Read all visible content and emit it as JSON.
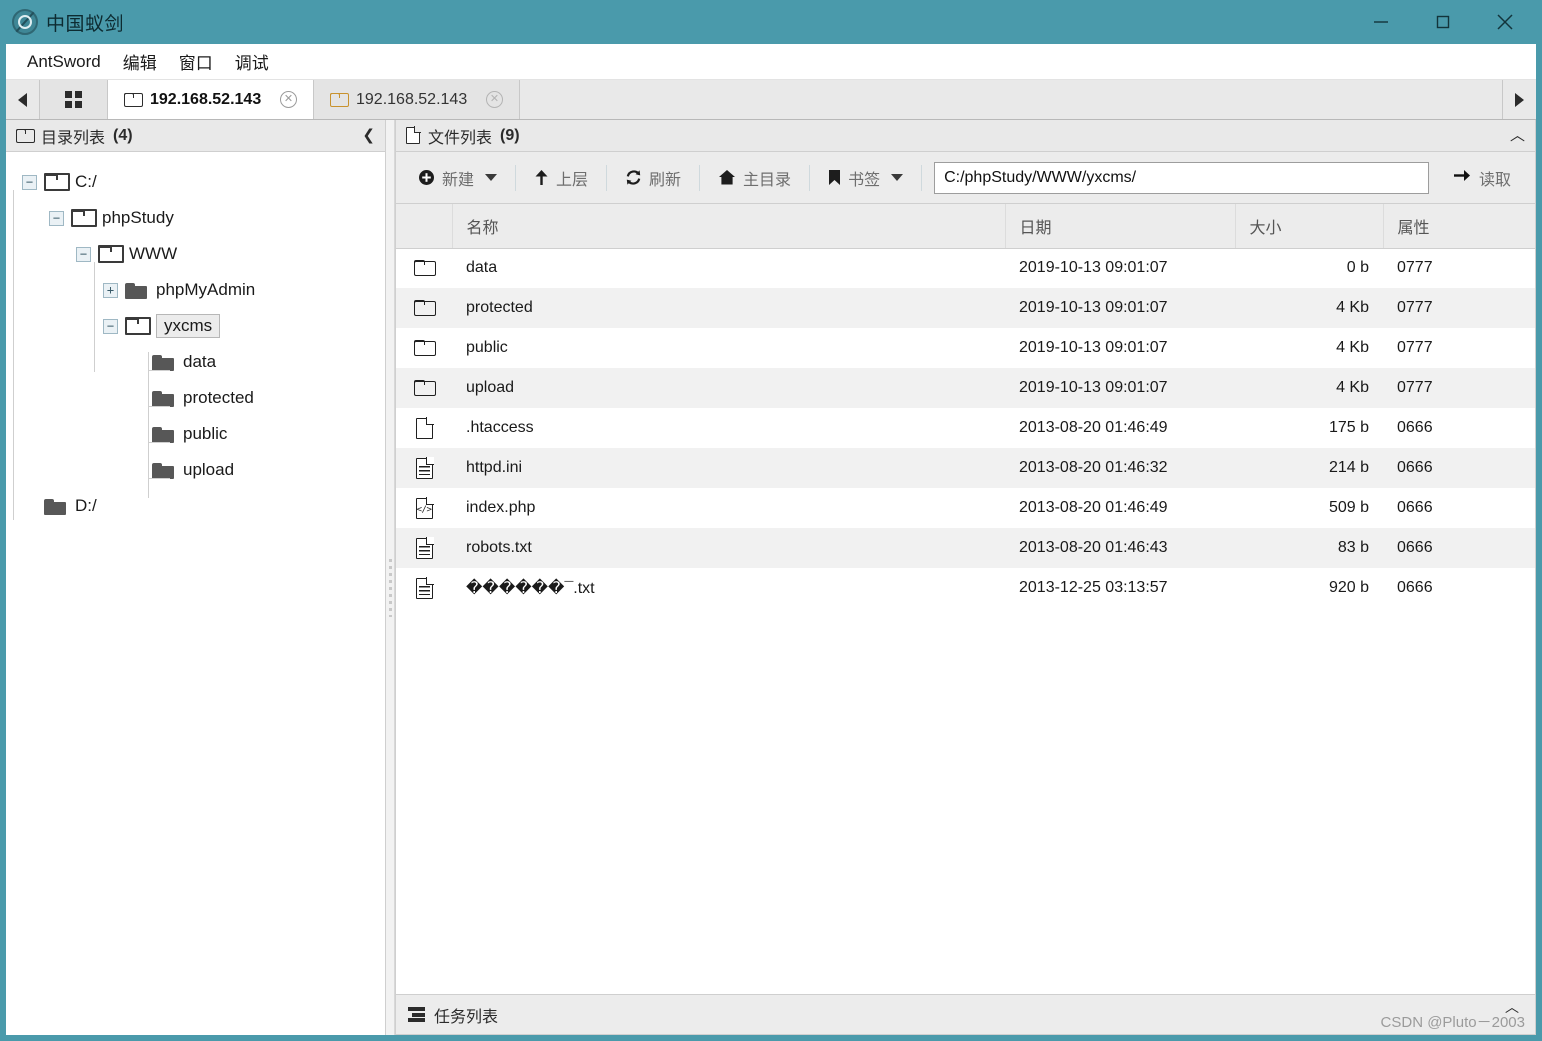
{
  "window": {
    "title": "中国蚁剑",
    "logo_icon": "antsword-logo-icon",
    "controls": {
      "minimize": "minimize-icon",
      "maximize": "maximize-icon",
      "close": "close-icon"
    }
  },
  "menubar": {
    "items": [
      {
        "label": "AntSword"
      },
      {
        "label": "编辑"
      },
      {
        "label": "窗口"
      },
      {
        "label": "调试"
      }
    ]
  },
  "tabbar": {
    "scroll_left_icon": "chevron-left-icon",
    "scroll_right_icon": "chevron-right-icon",
    "home_icon": "grid-icon",
    "tabs": [
      {
        "label": "192.168.52.143",
        "active": true,
        "close_icon": "close-circle-icon"
      },
      {
        "label": "192.168.52.143",
        "active": false,
        "close_icon": "close-circle-icon"
      }
    ]
  },
  "sidebar": {
    "header": {
      "icon": "folder-icon",
      "title": "目录列表",
      "count": "(4)",
      "collapse_icon": "chevron-left-icon"
    },
    "tree": [
      {
        "label": "C:/",
        "depth": 0,
        "toggle": "minus",
        "folder": "open",
        "selected": false
      },
      {
        "label": "phpStudy",
        "depth": 1,
        "toggle": "minus",
        "folder": "open",
        "selected": false
      },
      {
        "label": "WWW",
        "depth": 2,
        "toggle": "minus",
        "folder": "open",
        "selected": false
      },
      {
        "label": "phpMyAdmin",
        "depth": 3,
        "toggle": "plus",
        "folder": "closed",
        "selected": false
      },
      {
        "label": "yxcms",
        "depth": 3,
        "toggle": "minus",
        "folder": "open",
        "selected": true
      },
      {
        "label": "data",
        "depth": 4,
        "toggle": "none",
        "folder": "closed",
        "selected": false
      },
      {
        "label": "protected",
        "depth": 4,
        "toggle": "none",
        "folder": "closed",
        "selected": false
      },
      {
        "label": "public",
        "depth": 4,
        "toggle": "none",
        "folder": "closed",
        "selected": false
      },
      {
        "label": "upload",
        "depth": 4,
        "toggle": "none",
        "folder": "closed",
        "selected": false
      },
      {
        "label": "D:/",
        "depth": 0,
        "toggle": "none",
        "folder": "closed",
        "selected": false
      }
    ]
  },
  "filelist": {
    "header": {
      "icon": "file-icon",
      "title": "文件列表",
      "count": "(9)",
      "collapse_icon": "chevron-up-icon"
    },
    "toolbar": {
      "new_label": "新建",
      "new_icon": "plus-circle-icon",
      "up_label": "上层",
      "up_icon": "arrow-up-icon",
      "refresh_label": "刷新",
      "refresh_icon": "refresh-icon",
      "home_label": "主目录",
      "home_icon": "home-icon",
      "bookmark_label": "书签",
      "bookmark_icon": "bookmark-icon",
      "read_label": "读取",
      "read_icon": "arrow-right-icon"
    },
    "path": {
      "value": "C:/phpStudy/WWW/yxcms/",
      "placeholder": "C:/phpStudy/WWW/yxcms/"
    },
    "columns": {
      "icon": "",
      "name": "名称",
      "date": "日期",
      "size": "大小",
      "attr": "属性"
    },
    "rows": [
      {
        "icon": "folder-icon",
        "name": "data",
        "date": "2019-10-13 09:01:07",
        "size": "0 b",
        "attr": "0777"
      },
      {
        "icon": "folder-icon",
        "name": "protected",
        "date": "2019-10-13 09:01:07",
        "size": "4 Kb",
        "attr": "0777"
      },
      {
        "icon": "folder-icon",
        "name": "public",
        "date": "2019-10-13 09:01:07",
        "size": "4 Kb",
        "attr": "0777"
      },
      {
        "icon": "folder-icon",
        "name": "upload",
        "date": "2019-10-13 09:01:07",
        "size": "4 Kb",
        "attr": "0777"
      },
      {
        "icon": "file-blank-icon",
        "name": ".htaccess",
        "date": "2013-08-20 01:46:49",
        "size": "175 b",
        "attr": "0666"
      },
      {
        "icon": "file-text-icon",
        "name": "httpd.ini",
        "date": "2013-08-20 01:46:32",
        "size": "214 b",
        "attr": "0666"
      },
      {
        "icon": "file-code-icon",
        "name": "index.php",
        "date": "2013-08-20 01:46:49",
        "size": "509 b",
        "attr": "0666"
      },
      {
        "icon": "file-text-icon",
        "name": "robots.txt",
        "date": "2013-08-20 01:46:43",
        "size": "83 b",
        "attr": "0666"
      },
      {
        "icon": "file-text-icon",
        "name": "������¯.txt",
        "date": "2013-12-25 03:13:57",
        "size": "920 b",
        "attr": "0666"
      }
    ]
  },
  "taskbar": {
    "icon": "task-list-icon",
    "label": "任务列表",
    "collapse_icon": "chevron-up-icon",
    "watermark": "CSDN @Pluto－2003"
  },
  "colors": {
    "accent_teal": "#4a9aab",
    "panel_gray": "#ececec",
    "row_alt": "#f1f1f1",
    "selection": "#ececec"
  }
}
